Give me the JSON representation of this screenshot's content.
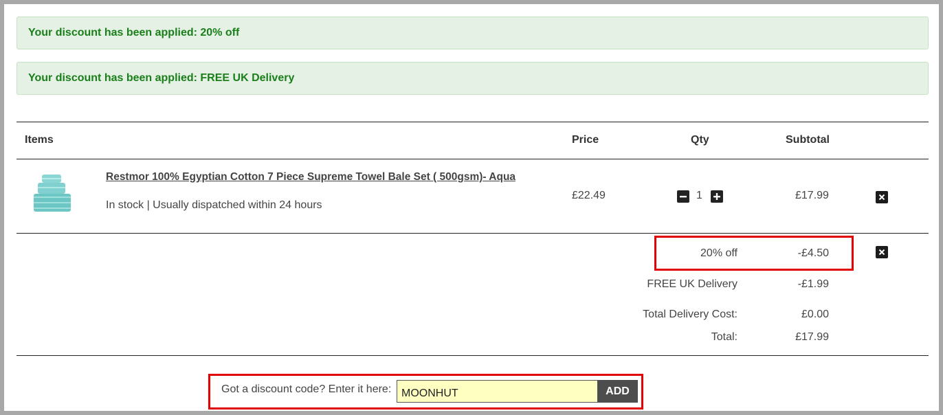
{
  "alerts": [
    {
      "text": "Your discount has been applied: 20% off"
    },
    {
      "text": "Your discount has been applied: FREE UK Delivery"
    }
  ],
  "table": {
    "headers": {
      "items": "Items",
      "price": "Price",
      "qty": "Qty",
      "subtotal": "Subtotal"
    }
  },
  "item": {
    "name": "Restmor 100% Egyptian Cotton 7 Piece Supreme Towel Bale Set ( 500gsm)- Aqua",
    "stock": "In stock | Usually dispatched within 24 hours",
    "price": "£22.49",
    "qty": "1",
    "subtotal": "£17.99",
    "thumb_color": "#7fd0cf"
  },
  "summary": {
    "discount_label": "20% off",
    "discount_value": "-£4.50",
    "delivery_discount_label": "FREE UK Delivery",
    "delivery_discount_value": "-£1.99",
    "delivery_cost_label": "Total Delivery Cost:",
    "delivery_cost_value": "£0.00",
    "total_label": "Total:",
    "total_value": "£17.99"
  },
  "discount_form": {
    "label": "Got a discount code? Enter it here:",
    "value": "MOONHUT",
    "button": "ADD"
  },
  "icons": {
    "minus": "minus-icon",
    "plus": "plus-icon",
    "remove": "close-icon"
  },
  "colors": {
    "alert_bg": "#e4f1e4",
    "alert_text": "#1a7f1a",
    "highlight": "#e00000",
    "input_bg": "#ffffc2"
  }
}
